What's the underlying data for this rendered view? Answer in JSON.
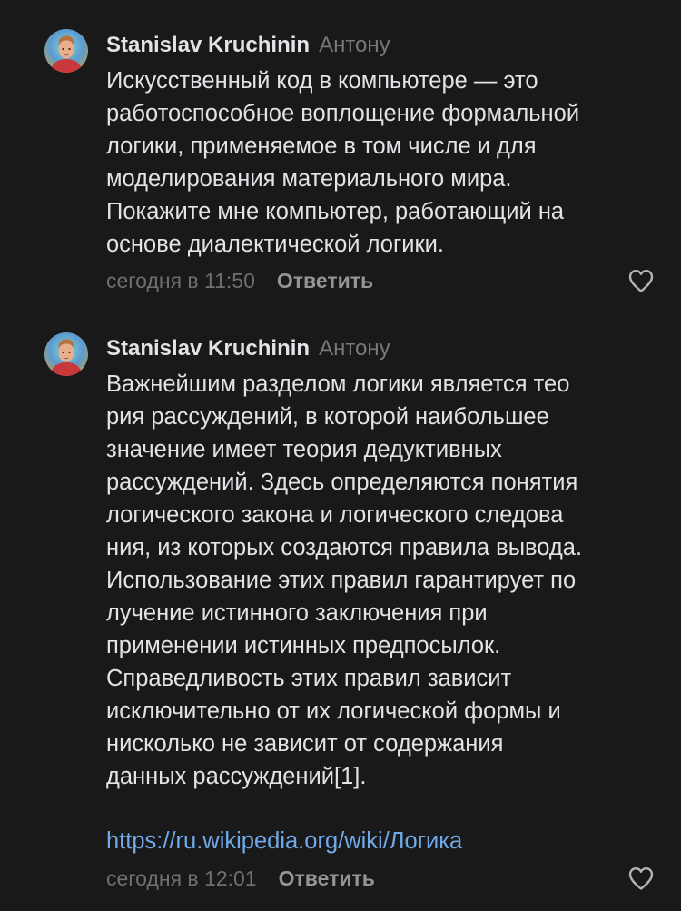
{
  "comments": [
    {
      "author": "Stanislav Kruchinin",
      "reply_to": "Антону",
      "text": "Искусственный код в компьютере — это\nработоспособное воплощение формальной\nлогики, применяемое в том числе и для\nмоделирования материального мира.\nПокажите мне компьютер, работающий на\nоснове диалектической логики.",
      "time": "сегодня в 11:50",
      "reply_label": "Ответить",
      "like_icon": "heart-outline-icon",
      "avatar_icon": "avatar-portrait"
    },
    {
      "author": "Stanislav Kruchinin",
      "reply_to": "Антону",
      "text": "Важнейшим разделом логики является тео\nрия рассуждений, в которой наибольшее\nзначение имеет теория дедуктивных\nрассуждений. Здесь определяются понятия\nлогического закона и логического следова\nния, из которых создаются правила вывода.\nИспользование этих правил гарантирует по\nлучение истинного заключения при\nприменении истинных предпосылок.\nСправедливость этих правил зависит\nисключительно от их логической формы и\nнисколько не зависит от содержания\nданных рассуждений[1].",
      "link": "https://ru.wikipedia.org/wiki/Логика",
      "time": "сегодня в 12:01",
      "reply_label": "Ответить",
      "like_icon": "heart-outline-icon",
      "avatar_icon": "avatar-portrait"
    }
  ],
  "colors": {
    "background": "#19191a",
    "text": "#e1e3e6",
    "secondary": "#76787a",
    "link": "#71aaeb"
  }
}
